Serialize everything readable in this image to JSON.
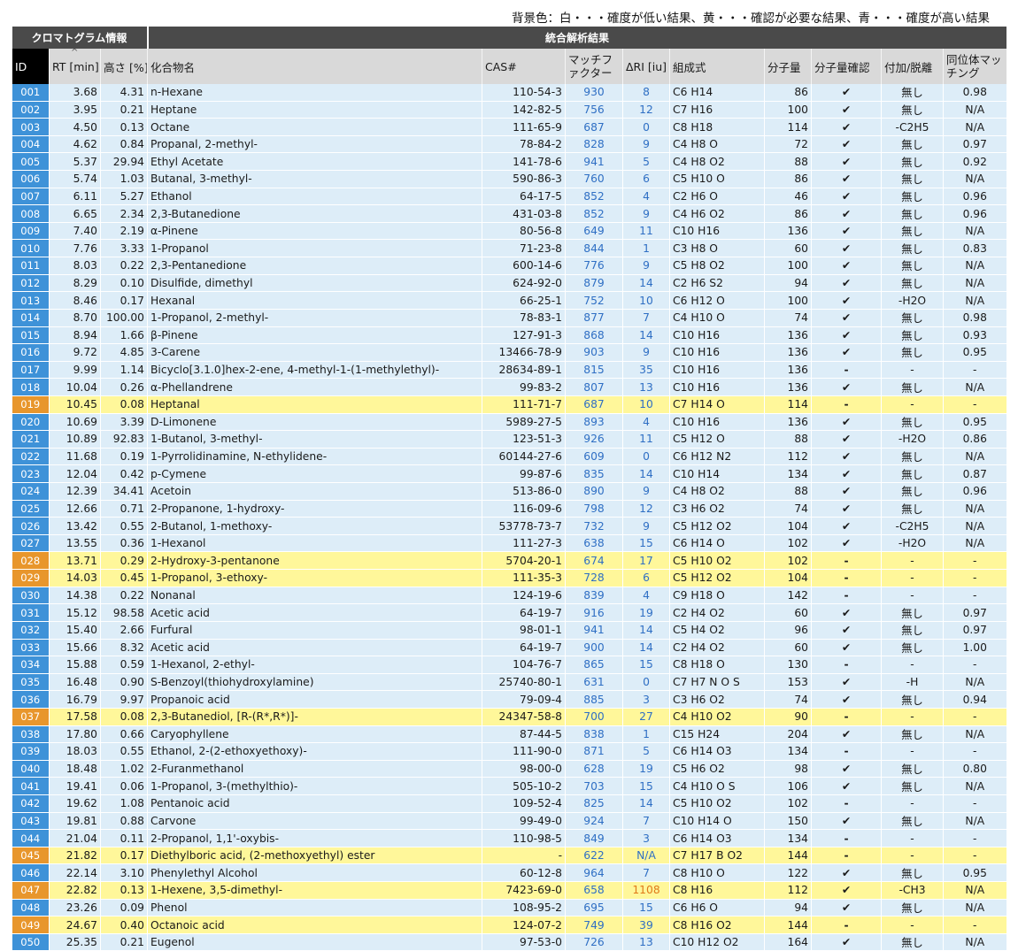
{
  "legend": "背景色：白・・・確度が低い結果、黄・・・確認が必要な結果、青・・・確度が高い結果",
  "groups": {
    "chrom": "クロマトグラム情報",
    "result": "統合解析結果"
  },
  "headers": {
    "id": "ID",
    "rt": "RT [min]",
    "height": "高さ [%]",
    "compound": "化合物名",
    "cas": "CAS#",
    "mf": "マッチファクター",
    "dri": "ΔRI [iu]",
    "formula": "組成式",
    "mw": "分子量",
    "mwcheck": "分子量確認",
    "adduct": "付加/脱離",
    "isotope": "同位体マッチング"
  },
  "rows": [
    {
      "id": "001",
      "rt": "3.68",
      "h": "4.31",
      "name": "n-Hexane",
      "cas": "110-54-3",
      "mf": "930",
      "dri": "8",
      "f": "C6 H14",
      "mw": "86",
      "chk": "✔",
      "add": "無し",
      "iso": "0.98",
      "bg": "b"
    },
    {
      "id": "002",
      "rt": "3.95",
      "h": "0.21",
      "name": "Heptane",
      "cas": "142-82-5",
      "mf": "756",
      "dri": "12",
      "f": "C7 H16",
      "mw": "100",
      "chk": "✔",
      "add": "無し",
      "iso": "N/A",
      "bg": "b"
    },
    {
      "id": "003",
      "rt": "4.50",
      "h": "0.13",
      "name": "Octane",
      "cas": "111-65-9",
      "mf": "687",
      "dri": "0",
      "f": "C8 H18",
      "mw": "114",
      "chk": "✔",
      "add": "-C2H5",
      "iso": "N/A",
      "bg": "b"
    },
    {
      "id": "004",
      "rt": "4.62",
      "h": "0.84",
      "name": "Propanal, 2-methyl-",
      "cas": "78-84-2",
      "mf": "828",
      "dri": "9",
      "f": "C4 H8 O",
      "mw": "72",
      "chk": "✔",
      "add": "無し",
      "iso": "0.97",
      "bg": "b"
    },
    {
      "id": "005",
      "rt": "5.37",
      "h": "29.94",
      "name": "Ethyl Acetate",
      "cas": "141-78-6",
      "mf": "941",
      "dri": "5",
      "f": "C4 H8 O2",
      "mw": "88",
      "chk": "✔",
      "add": "無し",
      "iso": "0.92",
      "bg": "b"
    },
    {
      "id": "006",
      "rt": "5.74",
      "h": "1.03",
      "name": "Butanal, 3-methyl-",
      "cas": "590-86-3",
      "mf": "760",
      "dri": "6",
      "f": "C5 H10 O",
      "mw": "86",
      "chk": "✔",
      "add": "無し",
      "iso": "N/A",
      "bg": "b"
    },
    {
      "id": "007",
      "rt": "6.11",
      "h": "5.27",
      "name": "Ethanol",
      "cas": "64-17-5",
      "mf": "852",
      "dri": "4",
      "f": "C2 H6 O",
      "mw": "46",
      "chk": "✔",
      "add": "無し",
      "iso": "0.96",
      "bg": "b"
    },
    {
      "id": "008",
      "rt": "6.65",
      "h": "2.34",
      "name": "2,3-Butanedione",
      "cas": "431-03-8",
      "mf": "852",
      "dri": "9",
      "f": "C4 H6 O2",
      "mw": "86",
      "chk": "✔",
      "add": "無し",
      "iso": "0.96",
      "bg": "b"
    },
    {
      "id": "009",
      "rt": "7.40",
      "h": "2.19",
      "name": "α-Pinene",
      "cas": "80-56-8",
      "mf": "649",
      "dri": "11",
      "f": "C10 H16",
      "mw": "136",
      "chk": "✔",
      "add": "無し",
      "iso": "N/A",
      "bg": "b"
    },
    {
      "id": "010",
      "rt": "7.76",
      "h": "3.33",
      "name": "1-Propanol",
      "cas": "71-23-8",
      "mf": "844",
      "dri": "1",
      "f": "C3 H8 O",
      "mw": "60",
      "chk": "✔",
      "add": "無し",
      "iso": "0.83",
      "bg": "b"
    },
    {
      "id": "011",
      "rt": "8.03",
      "h": "0.22",
      "name": "2,3-Pentanedione",
      "cas": "600-14-6",
      "mf": "776",
      "dri": "9",
      "f": "C5 H8 O2",
      "mw": "100",
      "chk": "✔",
      "add": "無し",
      "iso": "N/A",
      "bg": "b"
    },
    {
      "id": "012",
      "rt": "8.29",
      "h": "0.10",
      "name": "Disulfide, dimethyl",
      "cas": "624-92-0",
      "mf": "879",
      "dri": "14",
      "f": "C2 H6 S2",
      "mw": "94",
      "chk": "✔",
      "add": "無し",
      "iso": "N/A",
      "bg": "b"
    },
    {
      "id": "013",
      "rt": "8.46",
      "h": "0.17",
      "name": "Hexanal",
      "cas": "66-25-1",
      "mf": "752",
      "dri": "10",
      "f": "C6 H12 O",
      "mw": "100",
      "chk": "✔",
      "add": "-H2O",
      "iso": "N/A",
      "bg": "b"
    },
    {
      "id": "014",
      "rt": "8.70",
      "h": "100.00",
      "name": "1-Propanol, 2-methyl-",
      "cas": "78-83-1",
      "mf": "877",
      "dri": "7",
      "f": "C4 H10 O",
      "mw": "74",
      "chk": "✔",
      "add": "無し",
      "iso": "0.98",
      "bg": "b"
    },
    {
      "id": "015",
      "rt": "8.94",
      "h": "1.66",
      "name": "β-Pinene",
      "cas": "127-91-3",
      "mf": "868",
      "dri": "14",
      "f": "C10 H16",
      "mw": "136",
      "chk": "✔",
      "add": "無し",
      "iso": "0.93",
      "bg": "b"
    },
    {
      "id": "016",
      "rt": "9.72",
      "h": "4.85",
      "name": "3-Carene",
      "cas": "13466-78-9",
      "mf": "903",
      "dri": "9",
      "f": "C10 H16",
      "mw": "136",
      "chk": "✔",
      "add": "無し",
      "iso": "0.95",
      "bg": "b"
    },
    {
      "id": "017",
      "rt": "9.99",
      "h": "1.14",
      "name": "Bicyclo[3.1.0]hex-2-ene, 4-methyl-1-(1-methylethyl)-",
      "cas": "28634-89-1",
      "mf": "815",
      "dri": "35",
      "f": "C10 H16",
      "mw": "136",
      "chk": "-",
      "add": "-",
      "iso": "-",
      "bg": "b"
    },
    {
      "id": "018",
      "rt": "10.04",
      "h": "0.26",
      "name": "α-Phellandrene",
      "cas": "99-83-2",
      "mf": "807",
      "dri": "13",
      "f": "C10 H16",
      "mw": "136",
      "chk": "✔",
      "add": "無し",
      "iso": "N/A",
      "bg": "b"
    },
    {
      "id": "019",
      "rt": "10.45",
      "h": "0.08",
      "name": "Heptanal",
      "cas": "111-71-7",
      "mf": "687",
      "dri": "10",
      "f": "C7 H14 O",
      "mw": "114",
      "chk": "-",
      "add": "-",
      "iso": "-",
      "bg": "y"
    },
    {
      "id": "020",
      "rt": "10.69",
      "h": "3.39",
      "name": "D-Limonene",
      "cas": "5989-27-5",
      "mf": "893",
      "dri": "4",
      "f": "C10 H16",
      "mw": "136",
      "chk": "✔",
      "add": "無し",
      "iso": "0.95",
      "bg": "b"
    },
    {
      "id": "021",
      "rt": "10.89",
      "h": "92.83",
      "name": "1-Butanol, 3-methyl-",
      "cas": "123-51-3",
      "mf": "926",
      "dri": "11",
      "f": "C5 H12 O",
      "mw": "88",
      "chk": "✔",
      "add": "-H2O",
      "iso": "0.86",
      "bg": "b"
    },
    {
      "id": "022",
      "rt": "11.68",
      "h": "0.19",
      "name": "1-Pyrrolidinamine, N-ethylidene-",
      "cas": "60144-27-6",
      "mf": "609",
      "dri": "0",
      "f": "C6 H12 N2",
      "mw": "112",
      "chk": "✔",
      "add": "無し",
      "iso": "N/A",
      "bg": "b"
    },
    {
      "id": "023",
      "rt": "12.04",
      "h": "0.42",
      "name": "p-Cymene",
      "cas": "99-87-6",
      "mf": "835",
      "dri": "14",
      "f": "C10 H14",
      "mw": "134",
      "chk": "✔",
      "add": "無し",
      "iso": "0.87",
      "bg": "b"
    },
    {
      "id": "024",
      "rt": "12.39",
      "h": "34.41",
      "name": "Acetoin",
      "cas": "513-86-0",
      "mf": "890",
      "dri": "9",
      "f": "C4 H8 O2",
      "mw": "88",
      "chk": "✔",
      "add": "無し",
      "iso": "0.96",
      "bg": "b"
    },
    {
      "id": "025",
      "rt": "12.66",
      "h": "0.71",
      "name": "2-Propanone, 1-hydroxy-",
      "cas": "116-09-6",
      "mf": "798",
      "dri": "12",
      "f": "C3 H6 O2",
      "mw": "74",
      "chk": "✔",
      "add": "無し",
      "iso": "N/A",
      "bg": "b"
    },
    {
      "id": "026",
      "rt": "13.42",
      "h": "0.55",
      "name": "2-Butanol, 1-methoxy-",
      "cas": "53778-73-7",
      "mf": "732",
      "dri": "9",
      "f": "C5 H12 O2",
      "mw": "104",
      "chk": "✔",
      "add": "-C2H5",
      "iso": "N/A",
      "bg": "b"
    },
    {
      "id": "027",
      "rt": "13.55",
      "h": "0.36",
      "name": "1-Hexanol",
      "cas": "111-27-3",
      "mf": "638",
      "dri": "15",
      "f": "C6 H14 O",
      "mw": "102",
      "chk": "✔",
      "add": "-H2O",
      "iso": "N/A",
      "bg": "b"
    },
    {
      "id": "028",
      "rt": "13.71",
      "h": "0.29",
      "name": "2-Hydroxy-3-pentanone",
      "cas": "5704-20-1",
      "mf": "674",
      "dri": "17",
      "f": "C5 H10 O2",
      "mw": "102",
      "chk": "-",
      "add": "-",
      "iso": "-",
      "bg": "y"
    },
    {
      "id": "029",
      "rt": "14.03",
      "h": "0.45",
      "name": "1-Propanol, 3-ethoxy-",
      "cas": "111-35-3",
      "mf": "728",
      "dri": "6",
      "f": "C5 H12 O2",
      "mw": "104",
      "chk": "-",
      "add": "-",
      "iso": "-",
      "bg": "y"
    },
    {
      "id": "030",
      "rt": "14.38",
      "h": "0.22",
      "name": "Nonanal",
      "cas": "124-19-6",
      "mf": "839",
      "dri": "4",
      "f": "C9 H18 O",
      "mw": "142",
      "chk": "-",
      "add": "-",
      "iso": "-",
      "bg": "b"
    },
    {
      "id": "031",
      "rt": "15.12",
      "h": "98.58",
      "name": "Acetic acid",
      "cas": "64-19-7",
      "mf": "916",
      "dri": "19",
      "f": "C2 H4 O2",
      "mw": "60",
      "chk": "✔",
      "add": "無し",
      "iso": "0.97",
      "bg": "b"
    },
    {
      "id": "032",
      "rt": "15.40",
      "h": "2.66",
      "name": "Furfural",
      "cas": "98-01-1",
      "mf": "941",
      "dri": "14",
      "f": "C5 H4 O2",
      "mw": "96",
      "chk": "✔",
      "add": "無し",
      "iso": "0.97",
      "bg": "b"
    },
    {
      "id": "033",
      "rt": "15.66",
      "h": "8.32",
      "name": "Acetic acid",
      "cas": "64-19-7",
      "mf": "900",
      "dri": "14",
      "f": "C2 H4 O2",
      "mw": "60",
      "chk": "✔",
      "add": "無し",
      "iso": "1.00",
      "bg": "b"
    },
    {
      "id": "034",
      "rt": "15.88",
      "h": "0.59",
      "name": "1-Hexanol, 2-ethyl-",
      "cas": "104-76-7",
      "mf": "865",
      "dri": "15",
      "f": "C8 H18 O",
      "mw": "130",
      "chk": "-",
      "add": "-",
      "iso": "-",
      "bg": "b"
    },
    {
      "id": "035",
      "rt": "16.48",
      "h": "0.90",
      "name": "S-Benzoyl(thiohydroxylamine)",
      "cas": "25740-80-1",
      "mf": "631",
      "dri": "0",
      "f": "C7 H7 N O S",
      "mw": "153",
      "chk": "✔",
      "add": "-H",
      "iso": "N/A",
      "bg": "b"
    },
    {
      "id": "036",
      "rt": "16.79",
      "h": "9.97",
      "name": "Propanoic acid",
      "cas": "79-09-4",
      "mf": "885",
      "dri": "3",
      "f": "C3 H6 O2",
      "mw": "74",
      "chk": "✔",
      "add": "無し",
      "iso": "0.94",
      "bg": "b"
    },
    {
      "id": "037",
      "rt": "17.58",
      "h": "0.08",
      "name": "2,3-Butanediol, [R-(R*,R*)]-",
      "cas": "24347-58-8",
      "mf": "700",
      "dri": "27",
      "f": "C4 H10 O2",
      "mw": "90",
      "chk": "-",
      "add": "-",
      "iso": "-",
      "bg": "y"
    },
    {
      "id": "038",
      "rt": "17.80",
      "h": "0.66",
      "name": "Caryophyllene",
      "cas": "87-44-5",
      "mf": "838",
      "dri": "1",
      "f": "C15 H24",
      "mw": "204",
      "chk": "✔",
      "add": "無し",
      "iso": "N/A",
      "bg": "b"
    },
    {
      "id": "039",
      "rt": "18.03",
      "h": "0.55",
      "name": "Ethanol, 2-(2-ethoxyethoxy)-",
      "cas": "111-90-0",
      "mf": "871",
      "dri": "5",
      "f": "C6 H14 O3",
      "mw": "134",
      "chk": "-",
      "add": "-",
      "iso": "-",
      "bg": "b"
    },
    {
      "id": "040",
      "rt": "18.48",
      "h": "1.02",
      "name": "2-Furanmethanol",
      "cas": "98-00-0",
      "mf": "628",
      "dri": "19",
      "f": "C5 H6 O2",
      "mw": "98",
      "chk": "✔",
      "add": "無し",
      "iso": "0.80",
      "bg": "b"
    },
    {
      "id": "041",
      "rt": "19.41",
      "h": "0.06",
      "name": "1-Propanol, 3-(methylthio)-",
      "cas": "505-10-2",
      "mf": "703",
      "dri": "15",
      "f": "C4 H10 O S",
      "mw": "106",
      "chk": "✔",
      "add": "無し",
      "iso": "N/A",
      "bg": "b"
    },
    {
      "id": "042",
      "rt": "19.62",
      "h": "1.08",
      "name": "Pentanoic acid",
      "cas": "109-52-4",
      "mf": "825",
      "dri": "14",
      "f": "C5 H10 O2",
      "mw": "102",
      "chk": "-",
      "add": "-",
      "iso": "-",
      "bg": "b"
    },
    {
      "id": "043",
      "rt": "19.81",
      "h": "0.88",
      "name": "Carvone",
      "cas": "99-49-0",
      "mf": "924",
      "dri": "7",
      "f": "C10 H14 O",
      "mw": "150",
      "chk": "✔",
      "add": "無し",
      "iso": "N/A",
      "bg": "b"
    },
    {
      "id": "044",
      "rt": "21.04",
      "h": "0.11",
      "name": "2-Propanol, 1,1'-oxybis-",
      "cas": "110-98-5",
      "mf": "849",
      "dri": "3",
      "f": "C6 H14 O3",
      "mw": "134",
      "chk": "-",
      "add": "-",
      "iso": "-",
      "bg": "b"
    },
    {
      "id": "045",
      "rt": "21.82",
      "h": "0.17",
      "name": "Diethylboric acid, (2-methoxyethyl) ester",
      "cas": "-",
      "mf": "622",
      "dri": "N/A",
      "f": "C7 H17 B O2",
      "mw": "144",
      "chk": "-",
      "add": "-",
      "iso": "-",
      "bg": "y"
    },
    {
      "id": "046",
      "rt": "22.14",
      "h": "3.10",
      "name": "Phenylethyl Alcohol",
      "cas": "60-12-8",
      "mf": "964",
      "dri": "7",
      "f": "C8 H10 O",
      "mw": "122",
      "chk": "✔",
      "add": "無し",
      "iso": "0.95",
      "bg": "b"
    },
    {
      "id": "047",
      "rt": "22.82",
      "h": "0.13",
      "name": "1-Hexene, 3,5-dimethyl-",
      "cas": "7423-69-0",
      "mf": "658",
      "dri": "1108",
      "f": "C8 H16",
      "mw": "112",
      "chk": "✔",
      "add": "-CH3",
      "iso": "N/A",
      "bg": "y",
      "dri_color": "#e07a1a"
    },
    {
      "id": "048",
      "rt": "23.26",
      "h": "0.09",
      "name": "Phenol",
      "cas": "108-95-2",
      "mf": "695",
      "dri": "15",
      "f": "C6 H6 O",
      "mw": "94",
      "chk": "✔",
      "add": "無し",
      "iso": "N/A",
      "bg": "b"
    },
    {
      "id": "049",
      "rt": "24.67",
      "h": "0.40",
      "name": "Octanoic acid",
      "cas": "124-07-2",
      "mf": "749",
      "dri": "39",
      "f": "C8 H16 O2",
      "mw": "144",
      "chk": "-",
      "add": "-",
      "iso": "-",
      "bg": "y"
    },
    {
      "id": "050",
      "rt": "25.35",
      "h": "0.21",
      "name": "Eugenol",
      "cas": "97-53-0",
      "mf": "726",
      "dri": "13",
      "f": "C10 H12 O2",
      "mw": "164",
      "chk": "✔",
      "add": "無し",
      "iso": "N/A",
      "bg": "b"
    }
  ],
  "colors": {
    "blue_row": "#ddedf8",
    "yellow_row": "#fff79a",
    "id_blue": "#3e92d8",
    "id_orange": "#e8962c",
    "value_blue": "#2f6fc4",
    "value_orange": "#e07a1a"
  }
}
